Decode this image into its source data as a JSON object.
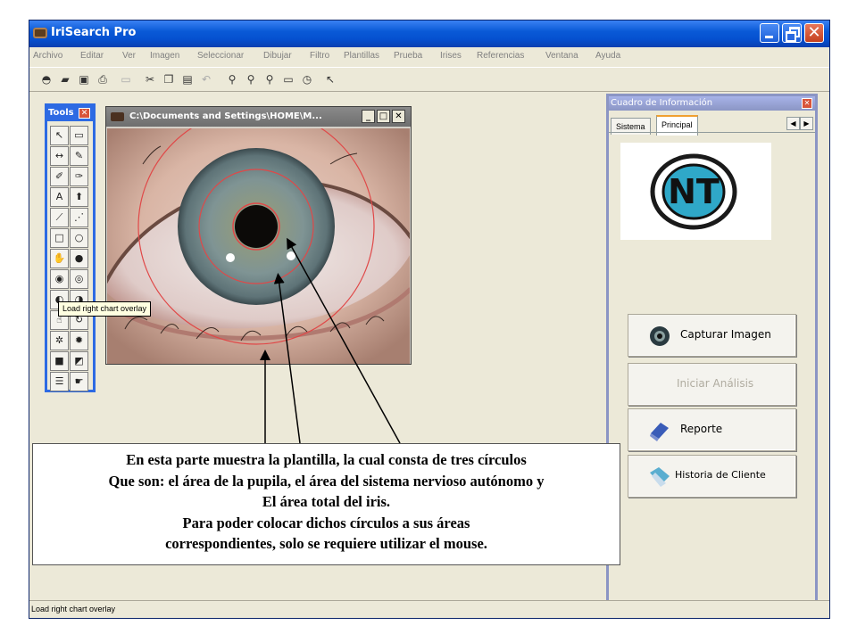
{
  "window": {
    "title": "IriSearch Pro",
    "icon": "app-icon",
    "controls": [
      "minimize-icon",
      "restore-icon",
      "close-icon"
    ]
  },
  "menu": {
    "items": [
      "Archivo",
      "Editar",
      "Ver",
      "Imagen",
      "Seleccionar",
      "Dibujar",
      "Filtro",
      "Plantillas",
      "Prueba",
      "Irises",
      "Referencias",
      "Ventana",
      "Ayuda"
    ]
  },
  "toolbar": {
    "icons": [
      "open-icon",
      "open-folder-icon",
      "save-icon",
      "print-icon",
      "scan-icon",
      "cut-icon",
      "copy-icon",
      "paste-icon",
      "undo-icon",
      "zoom-in-icon",
      "zoom-out-icon",
      "zoom-icon",
      "monitor-icon",
      "clock-icon",
      "help-pointer-icon"
    ]
  },
  "tools": {
    "title": "Tools",
    "tooltip": "Load right chart overlay"
  },
  "image_window": {
    "title": "C:\\Documents and Settings\\HOME\\M..."
  },
  "info_panel": {
    "title": "Cuadro de Información",
    "tabs": [
      "Sistema",
      "Principal"
    ],
    "active_tab": "Principal",
    "logo_text": "NT",
    "buttons": {
      "capture": "Capturar Imagen",
      "analysis": "Iniciar Análisis",
      "report": "Reporte",
      "history": "Historia de Cliente"
    }
  },
  "status": {
    "text": "Load right chart overlay"
  },
  "callout": {
    "lines": [
      "En esta parte muestra la plantilla, la cual consta de tres círculos",
      "Que son: el área de la pupila, el área del sistema nervioso autónomo y",
      "El área total del iris.",
      "Para poder colocar dichos círculos a sus áreas",
      "correspondientes, solo se requiere utilizar el mouse."
    ]
  },
  "colors": {
    "titlebar": "#0a5ad7",
    "tools_border": "#2d6ae3",
    "panel_border": "#8b95c4",
    "overlay_circle": "#e04848"
  }
}
